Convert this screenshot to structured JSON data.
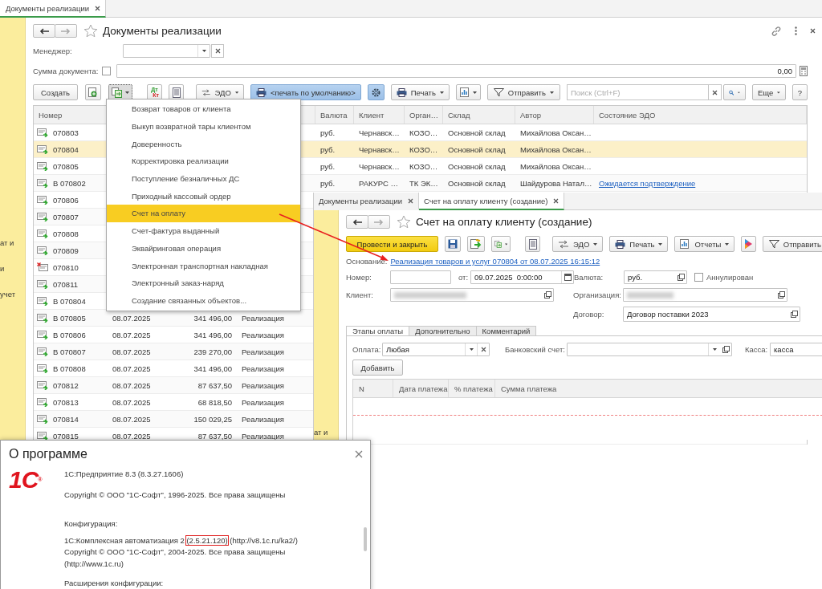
{
  "main_window": {
    "tab": {
      "label": "Документы реализации",
      "selected": true
    },
    "sidebar_texts": [
      "ат и",
      "и",
      "учет"
    ],
    "title": "Документы реализации",
    "manager": {
      "label": "Менеджер:"
    },
    "doc_sum": {
      "label": "Сумма документа:",
      "checked": false,
      "value": "0,00"
    },
    "toolbar": {
      "create": "Создать",
      "debit": "Дт",
      "credit": "Кт",
      "edo": "ЭДО",
      "default_print": "<печать по умолчанию>",
      "print": "Печать",
      "send": "Отправить",
      "search_placeholder": "Поиск (Ctrl+F)",
      "more": "Еще",
      "help": "?"
    },
    "table": {
      "columns": {
        "number": "Номер",
        "currency": "Валюта",
        "client": "Клиент",
        "organization": "Орган…",
        "warehouse": "Склад",
        "author": "Автор",
        "edo_status": "Состояние ЭДО"
      },
      "rows": [
        {
          "number": "070803",
          "kind": "posted",
          "selected": false,
          "currency": "руб.",
          "client": "Чернавск…",
          "organization": "КОЗО…",
          "warehouse": "Основной склад",
          "author": "Михайлова Оксан…"
        },
        {
          "number": "070804",
          "kind": "posted",
          "selected": true,
          "currency": "руб.",
          "client": "Чернавск…",
          "organization": "КОЗО…",
          "warehouse": "Основной склад",
          "author": "Михайлова Оксан…"
        },
        {
          "number": "070805",
          "kind": "posted",
          "selected": false,
          "currency": "руб.",
          "client": "Чернавск…",
          "organization": "КОЗО…",
          "warehouse": "Основной склад",
          "author": "Михайлова Оксан…"
        },
        {
          "number": "В 070802",
          "kind": "posted",
          "selected": false,
          "currency": "руб.",
          "client": "РАКУРС …",
          "organization": "ТК ЭК…",
          "warehouse": "Основной склад",
          "author": "Шайдурова Натал…",
          "edo_status": "Ожидается подтверждение"
        },
        {
          "number": "070806",
          "kind": "posted",
          "selected": false
        },
        {
          "number": "070807",
          "kind": "posted",
          "selected": false
        },
        {
          "number": "070808",
          "kind": "posted",
          "selected": false
        },
        {
          "number": "070809",
          "kind": "posted",
          "selected": false
        },
        {
          "number": "070810",
          "kind": "deleted",
          "selected": false
        },
        {
          "number": "070811",
          "kind": "posted",
          "selected": false
        },
        {
          "number": "В 070804",
          "kind": "posted",
          "selected": false
        },
        {
          "number": "В 070805",
          "kind": "posted",
          "selected": false,
          "date": "08.07.2025",
          "amount": "341 496,00",
          "operation": "Реализация"
        },
        {
          "number": "В 070806",
          "kind": "posted",
          "selected": false,
          "date": "08.07.2025",
          "amount": "341 496,00",
          "operation": "Реализация"
        },
        {
          "number": "В 070807",
          "kind": "posted",
          "selected": false,
          "date": "08.07.2025",
          "amount": "239 270,00",
          "operation": "Реализация"
        },
        {
          "number": "В 070808",
          "kind": "posted",
          "selected": false,
          "date": "08.07.2025",
          "amount": "341 496,00",
          "operation": "Реализация"
        },
        {
          "number": "070812",
          "kind": "posted",
          "selected": false,
          "date": "08.07.2025",
          "amount": "87 637,50",
          "operation": "Реализация"
        },
        {
          "number": "070813",
          "kind": "posted",
          "selected": false,
          "date": "08.07.2025",
          "amount": "68 818,50",
          "operation": "Реализация"
        },
        {
          "number": "070814",
          "kind": "posted",
          "selected": false,
          "date": "08.07.2025",
          "amount": "150 029,25",
          "operation": "Реализация"
        },
        {
          "number": "070815",
          "kind": "posted",
          "selected": false,
          "date": "08.07.2025",
          "amount": "87 637,50",
          "operation": "Реализация"
        }
      ]
    }
  },
  "create_menu": {
    "items": [
      {
        "label": "Возврат товаров от клиента",
        "selected": false
      },
      {
        "label": "Выкуп возвратной тары клиентом",
        "selected": false
      },
      {
        "label": "Доверенность",
        "selected": false
      },
      {
        "label": "Корректировка реализации",
        "selected": false
      },
      {
        "label": "Поступление безналичных ДС",
        "selected": false
      },
      {
        "label": "Приходный кассовый ордер",
        "selected": false
      },
      {
        "label": "Счет на оплату",
        "selected": true
      },
      {
        "label": "Счет-фактура выданный",
        "selected": false
      },
      {
        "label": "Эквайринговая операция",
        "selected": false
      },
      {
        "label": "Электронная транспортная накладная",
        "selected": false
      },
      {
        "label": "Электронный заказ-наряд",
        "selected": false
      },
      {
        "label": "Создание связанных объектов...",
        "selected": false
      }
    ]
  },
  "invoice_window": {
    "tabs": [
      {
        "label": "Документы реализации",
        "selected": false
      },
      {
        "label": "Счет на оплату клиенту (создание)",
        "selected": true
      }
    ],
    "sidebar_texts": [
      "ат и"
    ],
    "title": "Счет на оплату клиенту (создание)",
    "toolbar": {
      "post_close": "Провести и закрыть",
      "edo": "ЭДО",
      "print": "Печать",
      "reports": "Отчеты",
      "send": "Отправить"
    },
    "basis": {
      "label": "Основание:",
      "link": "Реализация товаров и услуг 070804 от 08.07.2025 16:15:12"
    },
    "number": {
      "label": "Номер:"
    },
    "date": {
      "label": "от:",
      "value": "09.07.2025  0:00:00"
    },
    "currency": {
      "label": "Валюта:",
      "value": "руб."
    },
    "cancelled": {
      "label": "Аннулирован",
      "checked": false
    },
    "client": {
      "label": "Клиент:"
    },
    "organization": {
      "label": "Организация:"
    },
    "contract": {
      "label": "Договор:",
      "value": "Договор поставки 2023"
    },
    "form_tabs": [
      {
        "label": "Этапы оплаты",
        "selected": true
      },
      {
        "label": "Дополнительно",
        "selected": false
      },
      {
        "label": "Комментарий",
        "selected": false
      }
    ],
    "payment": {
      "label": "Оплата:",
      "value": "Любая"
    },
    "bank_account": {
      "label": "Банковский счет:"
    },
    "cash_desk": {
      "label": "Касса:",
      "value": "касса"
    },
    "add_button": "Добавить",
    "schedule_columns": [
      "N",
      "Дата платежа",
      "% платежа",
      "Сумма платежа"
    ]
  },
  "about_dialog": {
    "title": "О программе",
    "logo": "1С",
    "logo_mark": "®",
    "platform": "1С:Предприятие 8.3 (8.3.27.1606)",
    "platform_copyright": "Copyright © ООО \"1С-Софт\", 1996-2025. Все права защищены",
    "config_label": "Конфигурация:",
    "config": {
      "name": "1С:Комплексная автоматизация 2",
      "version": "(2.5.21.120)",
      "url": "(http://v8.1c.ru/ka2/)",
      "version_highlighted": true
    },
    "config_copyright": "Copyright © ООО \"1С-Софт\", 2004-2025. Все права защищены",
    "config_site": "(http://www.1c.ru)",
    "extensions_label": "Расширения конфигурации:"
  }
}
